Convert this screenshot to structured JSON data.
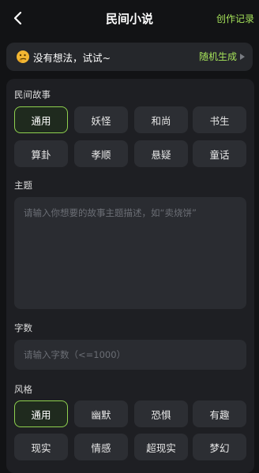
{
  "header": {
    "title": "民间小说",
    "right_action": "创作记录"
  },
  "idea_bar": {
    "text": "没有想法，试试~",
    "action": "随机生成"
  },
  "folk_story": {
    "label": "民间故事",
    "options": [
      "通用",
      "妖怪",
      "和尚",
      "书生",
      "算卦",
      "孝顺",
      "悬疑",
      "童话"
    ],
    "selected": "通用"
  },
  "theme": {
    "label": "主题",
    "placeholder": "请输入你想要的故事主题描述，如“卖烧饼”"
  },
  "word_count": {
    "label": "字数",
    "placeholder": "请输入字数（<=1000）"
  },
  "style": {
    "label": "风格",
    "options": [
      "通用",
      "幽默",
      "恐惧",
      "有趣",
      "现实",
      "情感",
      "超现实",
      "梦幻"
    ],
    "selected": "通用"
  },
  "colors": {
    "accent": "#a6e35a",
    "background": "#121315",
    "panel": "#1e1f23",
    "chip": "#2c2e33"
  }
}
